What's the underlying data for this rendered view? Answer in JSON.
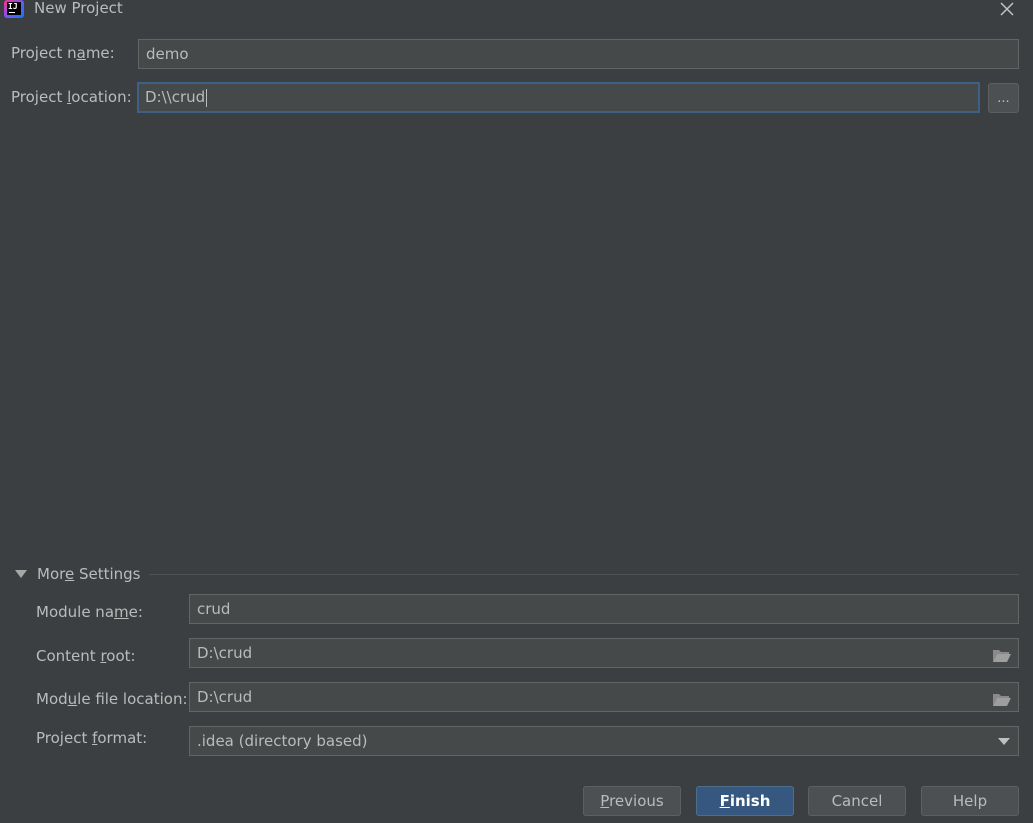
{
  "window": {
    "title": "New Project",
    "close_icon": "close-icon"
  },
  "project_name": {
    "label_pre": "Project n",
    "label_mn": "a",
    "label_post": "me:",
    "value": "demo"
  },
  "project_location": {
    "label_pre": "Project ",
    "label_mn": "l",
    "label_post": "ocation:",
    "value": "D:\\\\crud",
    "browse_label": "..."
  },
  "more_settings": {
    "label_pre": "Mor",
    "label_mn": "e",
    "label_post": " Settings",
    "expanded": true,
    "module_name": {
      "label_pre": "Module na",
      "label_mn": "m",
      "label_post": "e:",
      "value": "crud"
    },
    "content_root": {
      "label_pre": "Content ",
      "label_mn": "r",
      "label_post": "oot:",
      "value": "D:\\crud"
    },
    "module_file_location": {
      "label_pre": "Mod",
      "label_mn": "u",
      "label_post": "le file location:",
      "value": "D:\\crud"
    },
    "project_format": {
      "label_pre": "Project ",
      "label_mn": "f",
      "label_post": "ormat:",
      "value": ".idea (directory based)"
    }
  },
  "buttons": {
    "previous": {
      "mn": "P",
      "rest": "revious"
    },
    "finish": {
      "mn": "F",
      "rest": "inish"
    },
    "cancel": "Cancel",
    "help": "Help"
  },
  "colors": {
    "background": "#3c3f41",
    "field_bg": "#45494a",
    "focus_border": "#3d6185",
    "primary_button": "#365880",
    "text": "#bbbbbb"
  }
}
